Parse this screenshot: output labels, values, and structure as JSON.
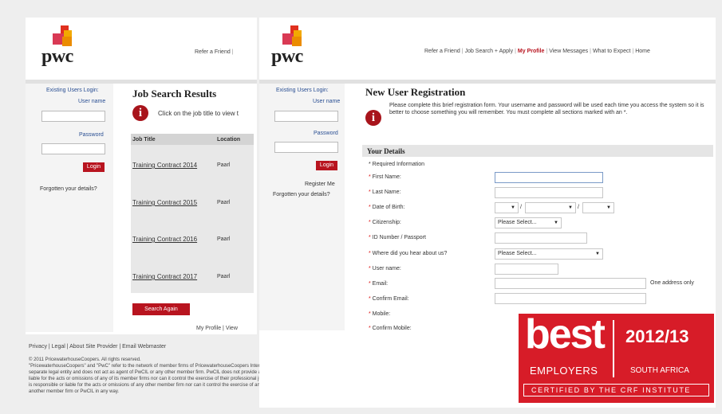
{
  "left_window": {
    "header": {
      "logo_text": "pwc",
      "nav_refer": "Refer a Friend"
    },
    "login": {
      "title": "Existing Users Login:",
      "username_label": "User name",
      "password_label": "Password",
      "login_button": "Login",
      "forgotten_link": "Forgotten your details?"
    },
    "results": {
      "title": "Job Search Results",
      "info_text": "Click on the job title to view t",
      "col_job_title": "Job Title",
      "col_location": "Location",
      "rows": [
        {
          "title": "Training Contract 2014",
          "location": "Paarl"
        },
        {
          "title": "Training Contract 2015",
          "location": "Paarl"
        },
        {
          "title": "Training Contract 2016",
          "location": "Paarl"
        },
        {
          "title": "Training Contract 2017",
          "location": "Paarl"
        }
      ],
      "search_again_button": "Search Again",
      "bottom_links": "My Profile | View"
    },
    "footer": {
      "links": "Privacy | Legal | About Site Provider | Email Webmaster",
      "copyright_lines": [
        "© 2011 PricewaterhouseCoopers. All rights reserved.",
        "\"PricewaterhouseCoopers\" and \"PwC\" refer to the network of member firms of PricewaterhouseCoopers International Limited (PwCIL). Each member firm is a",
        "separate legal entity and does not act as agent of PwCIL or any other member firm. PwCIL does not provide any services to clients. PwCIL is not responsible or",
        "liable for the acts or omissions of any of its member firms nor can it control the exercise of their professional judgment or bind them in any way. No member firm",
        "is responsible or liable for the acts or omissions of any other member firm nor can it control the exercise of another member firm's professional judgment or bind",
        "another member firm or PwCIL in any way."
      ]
    }
  },
  "right_window": {
    "header": {
      "logo_text": "pwc",
      "nav": [
        {
          "label": "Refer a Friend",
          "active": false
        },
        {
          "label": "Job Search + Apply",
          "active": false
        },
        {
          "label": "My Profile",
          "active": true
        },
        {
          "label": "View Messages",
          "active": false
        },
        {
          "label": "What to Expect",
          "active": false
        },
        {
          "label": "Home",
          "active": false
        }
      ]
    },
    "login": {
      "title": "Existing Users Login:",
      "username_label": "User name",
      "password_label": "Password",
      "login_button": "Login",
      "register_link": "Register Me",
      "forgotten_link": "Forgotten your details?"
    },
    "registration": {
      "title": "New User Registration",
      "intro": "Please complete this brief registration form. Your username and password will be used each time you access the system so it is better to choose something you will remember.  You must complete all sections marked with an *.",
      "section_title": "Your Details",
      "required_note": "* Required Information",
      "fields": {
        "first_name": "First Name:",
        "last_name": "Last Name:",
        "dob": "Date of Birth:",
        "citizenship": "Citizenship:",
        "id_number": "ID Number / Passport",
        "where_heard": "Where did you hear about us?",
        "username": "User name:",
        "email": "Email:",
        "confirm_email": "Confirm Email:",
        "mobile": "Mobile:",
        "confirm_mobile": "Confirm Mobile:"
      },
      "citizenship_selected": "Please Select...",
      "where_heard_selected": "Please Select...",
      "dob_separator": "/",
      "email_hint": "One address only"
    }
  },
  "badge": {
    "word": "best",
    "year": "2012/13",
    "employers": "EMPLOYERS",
    "region": "SOUTH AFRICA",
    "certified": "CERTIFIED BY THE CRF INSTITUTE",
    "color": "#d71c28"
  }
}
